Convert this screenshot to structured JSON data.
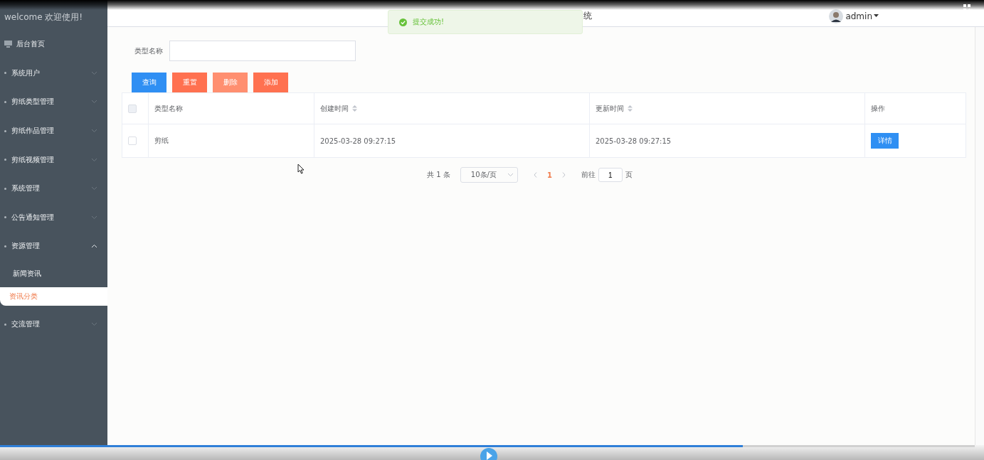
{
  "sidebar": {
    "welcome": "welcome 欢迎使用!",
    "items": [
      {
        "label": "后台首页",
        "kind": "home"
      },
      {
        "label": "系统用户",
        "kind": "group",
        "expanded": false
      },
      {
        "label": "剪纸类型管理",
        "kind": "group",
        "expanded": false
      },
      {
        "label": "剪纸作品管理",
        "kind": "group",
        "expanded": false
      },
      {
        "label": "剪纸视频管理",
        "kind": "group",
        "expanded": false
      },
      {
        "label": "系统管理",
        "kind": "group",
        "expanded": false
      },
      {
        "label": "公告通知管理",
        "kind": "group",
        "expanded": false
      },
      {
        "label": "资源管理",
        "kind": "group",
        "expanded": true,
        "children": [
          {
            "label": "新闻资讯",
            "selected": false
          },
          {
            "label": "资讯分类",
            "selected": true
          }
        ]
      },
      {
        "label": "交流管理",
        "kind": "group",
        "expanded": false
      }
    ]
  },
  "header": {
    "title": "统",
    "user": "admin"
  },
  "toast": {
    "message": "提交成功!"
  },
  "search": {
    "label": "类型名称"
  },
  "buttons": [
    {
      "label": "查询",
      "kind": "primary"
    },
    {
      "label": "重置",
      "kind": "danger"
    },
    {
      "label": "删除",
      "kind": "disabled"
    },
    {
      "label": "添加",
      "kind": "danger"
    }
  ],
  "table": {
    "columns": [
      {
        "label": "类型名称",
        "sortable": false
      },
      {
        "label": "创建时间",
        "sortable": true
      },
      {
        "label": "更新时间",
        "sortable": true
      },
      {
        "label": "操作",
        "sortable": false
      }
    ],
    "header_checked": false,
    "rows": [
      {
        "checked": false,
        "name": "剪纸",
        "created": "2025-03-28 09:27:15",
        "updated": "2025-03-28 09:27:15",
        "action": "详情"
      }
    ]
  },
  "pagination": {
    "total": "共 1 条",
    "page_size": "10条/页",
    "pages": [
      {
        "label": "1",
        "selected": true
      }
    ],
    "goto_label": "前往",
    "goto_value": "1",
    "goto_suffix": "页"
  },
  "player": {
    "level": 0.762
  }
}
